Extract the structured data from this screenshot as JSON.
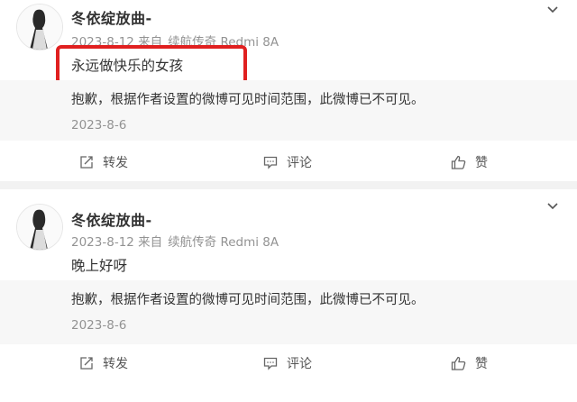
{
  "posts": [
    {
      "username": "冬依绽放曲-",
      "meta": "2023-8-12 来自",
      "device": "续航传奇 Redmi 8A",
      "text": "永远做快乐的女孩",
      "quote_notice": "抱歉，根据作者设置的微博可见时间范围，此微博已不可见。",
      "quote_date": "2023-8-6",
      "repost_label": "转发",
      "comment_label": "评论",
      "like_label": "赞"
    },
    {
      "username": "冬依绽放曲-",
      "meta": "2023-8-12 来自",
      "device": "续航传奇 Redmi 8A",
      "text": "晚上好呀",
      "quote_notice": "抱歉，根据作者设置的微博可见时间范围，此微博已不可见。",
      "quote_date": "2023-8-6",
      "repost_label": "转发",
      "comment_label": "评论",
      "like_label": "赞"
    }
  ],
  "colors": {
    "highlight": "#e02020",
    "meta": "#939393",
    "quote_bg": "#f7f7f7"
  },
  "icons": [
    "chevron-down-icon",
    "repost-icon",
    "comment-icon",
    "like-icon"
  ]
}
